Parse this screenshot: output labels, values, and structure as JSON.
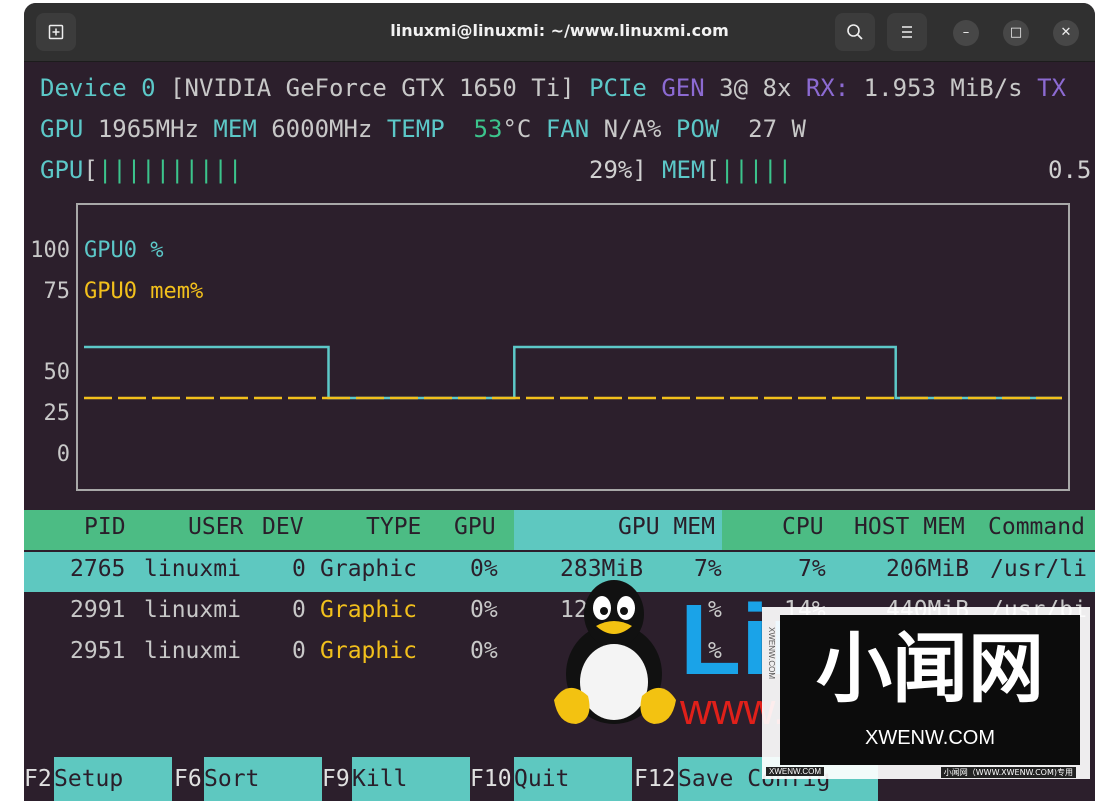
{
  "window": {
    "title": "linuxmi@linuxmi: ~/www.linuxmi.com",
    "new_tab_icon": "new-tab-icon",
    "search_icon": "search-icon",
    "menu_icon": "hamburger-menu-icon",
    "minimize_label": "–",
    "maximize_label": "□",
    "close_label": "✕"
  },
  "device": {
    "line1": {
      "device": "Device 0",
      "name": "[NVIDIA GeForce GTX 1650 Ti]",
      "pcie": "PCIe",
      "gen_label": "GEN",
      "gen": "3@",
      "width": "8x",
      "rx_label": "RX:",
      "rx": "1.953 MiB/s",
      "tx_label": "TX"
    },
    "line2": {
      "gpu_label": "GPU",
      "gpu_clock": "1965MHz",
      "mem_label": "MEM",
      "mem_clock": "6000MHz",
      "temp_label": "TEMP",
      "temp_value": "53",
      "temp_unit": "°C",
      "fan_label": "FAN",
      "fan_value": "N/A%",
      "pow_label": "POW",
      "pow_value": "27 W"
    },
    "line3": {
      "gpu_label": "GPU",
      "gpu_open": "[",
      "gpu_bars": "||||||||||",
      "gpu_pct": "29%]",
      "mem_label": "MEM",
      "mem_open": "[",
      "mem_bars": "|||||",
      "mem_pct": "0.5"
    }
  },
  "chart_data": {
    "type": "line",
    "y_ticks": [
      "100",
      "75",
      "50",
      "25",
      "0"
    ],
    "ylim": [
      0,
      100
    ],
    "series": [
      {
        "name": "GPU0 %",
        "color": "#5cc8c8",
        "points": [
          [
            0,
            50
          ],
          [
            25,
            50
          ],
          [
            25,
            25
          ],
          [
            44,
            25
          ],
          [
            44,
            50
          ],
          [
            83,
            50
          ],
          [
            83,
            25
          ],
          [
            100,
            25
          ]
        ]
      },
      {
        "name": "GPU0 mem%",
        "color": "#f2c01c",
        "points": [
          [
            0,
            25
          ],
          [
            100,
            25
          ]
        ]
      }
    ],
    "grid": false,
    "legend": "top-left"
  },
  "process_table": {
    "headers": [
      "PID",
      "USER",
      "DEV",
      "TYPE",
      "GPU",
      "GPU MEM",
      "CPU",
      "HOST MEM",
      "Command"
    ],
    "rows": [
      {
        "pid": "2765",
        "user": "linuxmi",
        "dev": "0",
        "type": "Graphic",
        "gpu": "0%",
        "gpu_mem": "283MiB",
        "gpu_mem_pct": "7%",
        "cpu": "7%",
        "host_mem": "206MiB",
        "command": "/usr/li",
        "selected": true
      },
      {
        "pid": "2991",
        "user": "linuxmi",
        "dev": "0",
        "type": "Graphic",
        "gpu": "0%",
        "gpu_mem": "12",
        "gpu_mem_pct": "%",
        "cpu": "14%",
        "host_mem": "440MiB",
        "command": "/usr/bi",
        "selected": false
      },
      {
        "pid": "2951",
        "user": "linuxmi",
        "dev": "0",
        "type": "Graphic",
        "gpu": "0%",
        "gpu_mem": "",
        "gpu_mem_pct": "%",
        "cpu": "",
        "host_mem": "",
        "command": "",
        "selected": false
      }
    ]
  },
  "function_keys": [
    {
      "key": "F2",
      "label": "Setup"
    },
    {
      "key": "F6",
      "label": "Sort"
    },
    {
      "key": "F9",
      "label": "Kill"
    },
    {
      "key": "F10",
      "label": "Quit"
    },
    {
      "key": "F12",
      "label": "Save Config"
    }
  ],
  "watermarks": {
    "linux_text": "Linux",
    "url_text": "www.linuxmi.com",
    "chinese_text": "小闻网",
    "xwenw_text": "XWENW.COM",
    "side_text": "XWENW.COM",
    "footer_left": "XWENW.COM",
    "footer_right": "小闻网（WWW.XWENW.COM)专用"
  }
}
